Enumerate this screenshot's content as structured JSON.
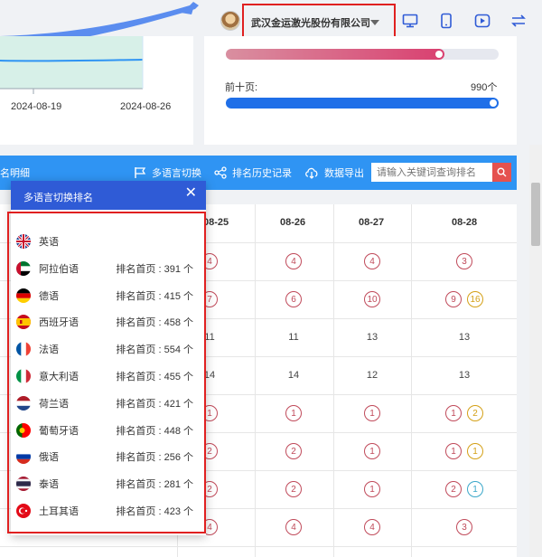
{
  "header": {
    "company_name": "武汉金运激光股份有限公司",
    "icons": [
      "avatar",
      "caret-down-icon",
      "monitor-icon",
      "mobile-icon",
      "play-icon",
      "switch-icon"
    ]
  },
  "trend_card": {
    "dates": [
      "2024-08-19",
      "2024-08-26"
    ]
  },
  "progress": {
    "top10_label": "前十页:",
    "top10_value": "990个",
    "top10_fraction": 1.0,
    "upper_fraction": 0.8
  },
  "toolbar": {
    "title_fragment": "名明细",
    "multilang": "多语言切换",
    "history": "排名历史记录",
    "export": "数据导出",
    "search_placeholder": "请输入关键词查询排名"
  },
  "table": {
    "headers": [
      "08-25",
      "08-26",
      "08-27",
      "08-28"
    ],
    "rows": [
      [
        [
          "4"
        ],
        [
          "4"
        ],
        [
          "4"
        ],
        [
          "3"
        ]
      ],
      [
        [
          "7"
        ],
        [
          "6"
        ],
        [
          "10"
        ],
        [
          "9",
          "16"
        ]
      ],
      [
        [
          "11"
        ],
        [
          "11"
        ],
        [
          "13"
        ],
        [
          "13"
        ]
      ],
      [
        [
          "14"
        ],
        [
          "14"
        ],
        [
          "12"
        ],
        [
          "13"
        ]
      ],
      [
        [
          "1"
        ],
        [
          "1"
        ],
        [
          "1"
        ],
        [
          "1",
          "2"
        ]
      ],
      [
        [
          "2"
        ],
        [
          "2"
        ],
        [
          "1"
        ],
        [
          "1",
          "1"
        ]
      ],
      [
        [
          "2"
        ],
        [
          "2"
        ],
        [
          "1"
        ],
        [
          "2",
          "1"
        ]
      ],
      [
        [
          "4"
        ],
        [
          "4"
        ],
        [
          "4"
        ],
        [
          "3"
        ]
      ]
    ]
  },
  "popup": {
    "title": "多语言切换排名",
    "close": "✕",
    "languages": [
      {
        "name": "英语",
        "count": "",
        "flag": "uk"
      },
      {
        "name": "阿拉伯语",
        "count": "排名首页 : 391 个",
        "flag": "ae"
      },
      {
        "name": "德语",
        "count": "排名首页 : 415 个",
        "flag": "de"
      },
      {
        "name": "西班牙语",
        "count": "排名首页 : 458 个",
        "flag": "es"
      },
      {
        "name": "法语",
        "count": "排名首页 : 554 个",
        "flag": "fr"
      },
      {
        "name": "意大利语",
        "count": "排名首页 : 455 个",
        "flag": "it"
      },
      {
        "name": "荷兰语",
        "count": "排名首页 : 421 个",
        "flag": "nl"
      },
      {
        "name": "葡萄牙语",
        "count": "排名首页 : 448 个",
        "flag": "pt"
      },
      {
        "name": "俄语",
        "count": "排名首页 : 256 个",
        "flag": "ru"
      },
      {
        "name": "泰语",
        "count": "排名首页 : 281 个",
        "flag": "th"
      },
      {
        "name": "土耳其语",
        "count": "排名首页 : 423 个",
        "flag": "tr"
      }
    ]
  },
  "colors": {
    "accent_blue": "#2f94f3",
    "popup_header": "#2f5bd6",
    "highlight_red": "#e02020",
    "rank_circle": "#c04a5a"
  }
}
